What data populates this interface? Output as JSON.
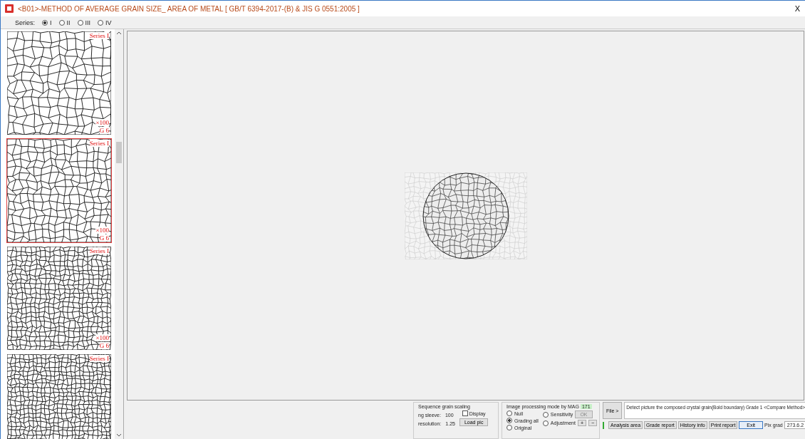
{
  "window": {
    "title": "<B01>-METHOD OF AVERAGE GRAIN SIZE_ AREA OF METAL [ GB/T 6394-2017-(B) & JIS G 0551:2005 ]",
    "close": "X"
  },
  "series_selector": {
    "label": "Series:",
    "options": [
      {
        "label": "I",
        "selected": true
      },
      {
        "label": "II",
        "selected": false
      },
      {
        "label": "III",
        "selected": false
      },
      {
        "label": "IV",
        "selected": false
      }
    ]
  },
  "thumbnails": [
    {
      "label": "Series  I",
      "magnification": "×100",
      "grade": "G 6",
      "selected": false
    },
    {
      "label": "Series  I",
      "magnification": "×100",
      "grade": "G 6",
      "selected": true
    },
    {
      "label": "Series  I",
      "magnification": "×100",
      "grade": "G 6",
      "selected": false
    },
    {
      "label": "Series  I",
      "selected": false
    }
  ],
  "grain_group": {
    "title": "Sequence grain scaling",
    "rows": [
      {
        "label": "ng sleeve:",
        "value": "100"
      },
      {
        "label": "resolution:",
        "value": "1.25"
      }
    ],
    "display": {
      "label": "Display",
      "checked": false
    },
    "load_button": "Load pic"
  },
  "mode_group": {
    "title": "Image processing mode by MAG",
    "value": "171",
    "options": [
      {
        "label": "Null",
        "selected": false
      },
      {
        "label": "Grading all",
        "selected": true
      },
      {
        "label": "Original",
        "selected": false
      }
    ],
    "sensitivity": {
      "label": "Sensitivity",
      "selected": false,
      "button": "OK"
    },
    "adjustment": {
      "label": "Adjustment",
      "selected": false,
      "plus": "+",
      "minus": "−"
    }
  },
  "file_button": "File >",
  "message": "Detect picture the composed crystal grain(Bold boundary) Grade 1 <Compare Method>",
  "actions": [
    "Analysis area",
    "Grade report",
    "History info",
    "Print report"
  ],
  "exit_field": "Exit",
  "pix_label": "Pix grad",
  "pix_value": "273.6.2"
}
